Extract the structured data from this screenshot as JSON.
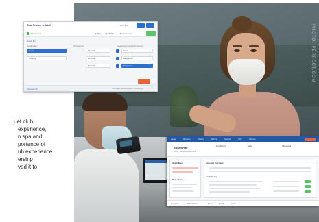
{
  "article": {
    "lines": [
      "uet club,",
      "experience,",
      "n spa and",
      "portance of",
      "ub experience.",
      "ership",
      "ved it to"
    ]
  },
  "photo": {
    "watermark": "PHOTO: PERFECT.COM"
  },
  "window_checkin": {
    "title": "Club Terrace — Adult",
    "top_link": "DAY 1 CI",
    "status_label": "Checked In",
    "meta_1": "Friday",
    "meta_2": "09:30 AM",
    "meta_3": "Drop Guests",
    "section_label": "Guest list",
    "col_left": "Cardholder",
    "col_mid": "Arrival time",
    "col_right": "Guest type (required before)",
    "rows": [
      {
        "name": "Guest",
        "time": "09:30 AM",
        "type": "Guest"
      },
      {
        "name": "Pickleball",
        "time": "09:30 AM",
        "type": "Recognition"
      },
      {
        "name": "",
        "time": "09:30 AM",
        "type": "Registered"
      }
    ],
    "footer_left": "Previous 60",
    "footer_right": "This week, Member, tennis & swimming"
  },
  "window_member": {
    "nav": [
      "Home",
      "Members",
      "Events",
      "Booking",
      "Reports",
      "Staff",
      "Settings"
    ],
    "name": "Susan Hall",
    "sub": "Active · Member since 2015",
    "col_1": "Membership",
    "col_2": "Status",
    "col_3": "Adventures",
    "panel_left_label": "Guest Book",
    "panel_left_2_label": "Notes Book",
    "panel_main_label": "Account Summary",
    "panel_main_2_label": "Activity Log",
    "tabs": [
      "Overview",
      "Transactions",
      "Notes",
      "Emails",
      "Alerts"
    ]
  },
  "colors": {
    "accent_blue": "#2d6fd0",
    "nav_blue": "#2458a6",
    "orange": "#e8623a",
    "green": "#5cc46a"
  }
}
